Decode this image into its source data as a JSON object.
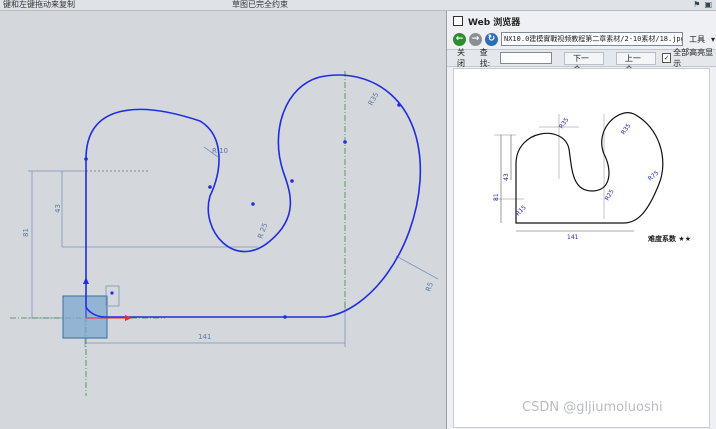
{
  "topbar": {
    "hint": "键和左键拖动来复制",
    "status": "草图已完全约束",
    "icons": [
      "flag-icon",
      "pin-icon"
    ]
  },
  "sketch": {
    "dimensions": {
      "d1": "R 10",
      "d2": "43",
      "d3": "81",
      "d4": "R 25",
      "d5": "R35",
      "d6": "141",
      "d7": "R5"
    },
    "colors": {
      "curve": "#1f2fe0",
      "dimension": "#5a78a8",
      "centerline": "#3c8c3c"
    }
  },
  "web_panel": {
    "title": "Web 浏览器",
    "url": "NX10.0建模實戰视频教程第二章素材/2-10素材/18.jpg",
    "tools_label": "工具",
    "find": {
      "close_label": "关闭",
      "find_label": "查找:",
      "next_label": "下一个",
      "prev_label": "上一个",
      "highlight_label": "全部高亮显示",
      "highlight_checked": true
    },
    "drawing": {
      "dims": [
        "R35",
        "R35",
        "43",
        "81",
        "R25",
        "R75",
        "R15",
        "141"
      ],
      "difficulty_label": "难度系数 ★★"
    }
  },
  "watermark": "CSDN @gljiumoluoshi"
}
